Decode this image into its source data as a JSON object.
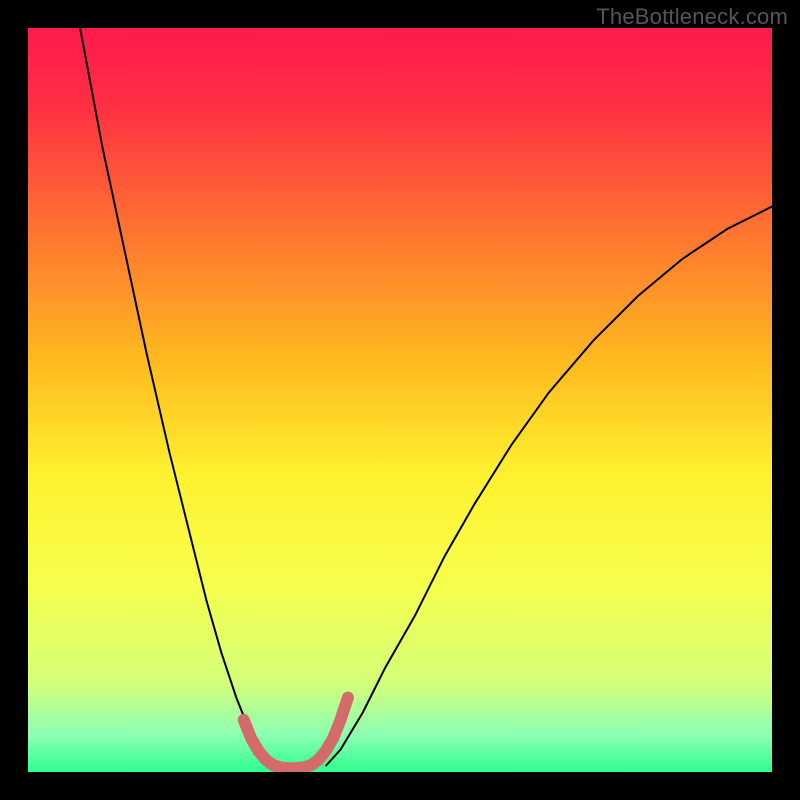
{
  "watermark": "TheBottleneck.com",
  "chart_data": {
    "type": "line",
    "title": "",
    "xlabel": "",
    "ylabel": "",
    "xlim": [
      0,
      100
    ],
    "ylim": [
      0,
      100
    ],
    "background_gradient": {
      "type": "vertical",
      "stops": [
        {
          "pos": 0.0,
          "color": "#ff1a4d"
        },
        {
          "pos": 0.1,
          "color": "#ff2e44"
        },
        {
          "pos": 0.25,
          "color": "#ff6a33"
        },
        {
          "pos": 0.45,
          "color": "#ffbb1f"
        },
        {
          "pos": 0.6,
          "color": "#fff12f"
        },
        {
          "pos": 0.75,
          "color": "#f6ff4d"
        },
        {
          "pos": 0.88,
          "color": "#d4ff7a"
        },
        {
          "pos": 0.95,
          "color": "#8dffb3"
        },
        {
          "pos": 1.0,
          "color": "#2eff8f"
        }
      ]
    },
    "series": [
      {
        "name": "left-curve",
        "color": "#000000",
        "stroke_width": 2,
        "x": [
          7,
          10,
          13,
          16,
          19,
          22,
          24,
          26,
          28,
          30,
          31.5,
          33
        ],
        "y": [
          100,
          84,
          70,
          56,
          43,
          31,
          23,
          16,
          10,
          5,
          2.5,
          0.8
        ]
      },
      {
        "name": "right-curve",
        "color": "#000000",
        "stroke_width": 2,
        "x": [
          40,
          42,
          45,
          48,
          52,
          56,
          60,
          65,
          70,
          76,
          82,
          88,
          94,
          100
        ],
        "y": [
          0.8,
          3,
          8,
          14,
          21,
          29,
          36,
          44,
          51,
          58,
          64,
          69,
          73,
          76
        ]
      },
      {
        "name": "bottleneck-highlight",
        "color": "#d46a6a",
        "stroke_width": 12,
        "linecap": "round",
        "x": [
          29,
          30,
          31,
          32,
          33,
          34,
          35,
          36,
          37,
          38,
          39,
          40,
          41,
          42,
          43
        ],
        "y": [
          7,
          4.5,
          2.8,
          1.6,
          0.9,
          0.6,
          0.5,
          0.5,
          0.6,
          0.9,
          1.6,
          2.8,
          4.5,
          7,
          10
        ]
      }
    ],
    "annotations": []
  }
}
